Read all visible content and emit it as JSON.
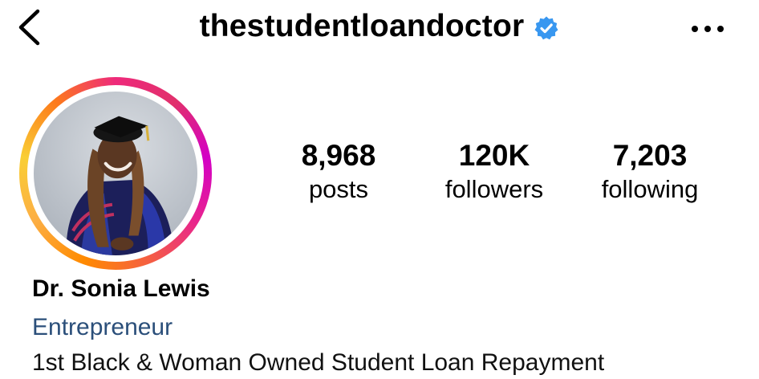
{
  "header": {
    "username": "thestudentloandoctor",
    "verified": true,
    "icons": {
      "back": "chevron-left-icon",
      "verified": "verified-badge-icon",
      "more": "more-horizontal-icon"
    },
    "verified_color": "#3897f0"
  },
  "stats": {
    "posts": {
      "count": "8,968",
      "label": "posts"
    },
    "followers": {
      "count": "120K",
      "label": "followers"
    },
    "following": {
      "count": "7,203",
      "label": "following"
    }
  },
  "profile": {
    "name": "Dr. Sonia Lewis",
    "category": "Entrepreneur",
    "bio_line": "1st Black & Woman Owned Student Loan Repayment",
    "category_color": "#2b4f7a"
  },
  "avatar": {
    "ring_colors": [
      "#fcaf45",
      "#f56040",
      "#e1306c",
      "#d300c5"
    ]
  }
}
